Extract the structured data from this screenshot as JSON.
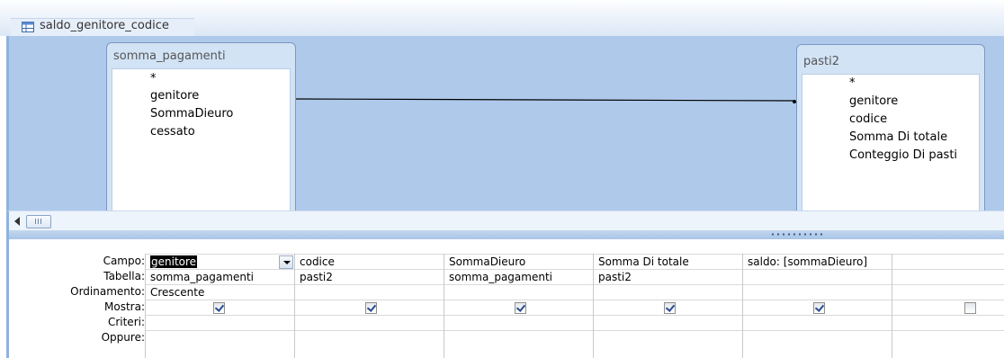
{
  "window": {
    "title": "saldo_genitore_codice"
  },
  "tables": [
    {
      "name": "somma_pagamenti",
      "fields": [
        "*",
        "genitore",
        "SommaDieuro",
        "cessato"
      ]
    },
    {
      "name": "pasti2",
      "fields": [
        "*",
        "genitore",
        "codice",
        "Somma Di totale",
        "Conteggio Di pasti"
      ]
    }
  ],
  "grid": {
    "row_labels": [
      "Campo:",
      "Tabella:",
      "Ordinamento:",
      "Mostra:",
      "Criteri:",
      "Oppure:"
    ],
    "columns": [
      {
        "campo": "genitore",
        "tabella": "somma_pagamenti",
        "ordinamento": "Crescente",
        "mostra": true,
        "criteri": "",
        "oppure": ""
      },
      {
        "campo": "codice",
        "tabella": "pasti2",
        "ordinamento": "",
        "mostra": true,
        "criteri": "",
        "oppure": ""
      },
      {
        "campo": "SommaDieuro",
        "tabella": "somma_pagamenti",
        "ordinamento": "",
        "mostra": true,
        "criteri": "",
        "oppure": ""
      },
      {
        "campo": "Somma Di totale",
        "tabella": "pasti2",
        "ordinamento": "",
        "mostra": true,
        "criteri": "",
        "oppure": ""
      },
      {
        "campo": "saldo: [sommaDieuro]",
        "tabella": "",
        "ordinamento": "",
        "mostra": true,
        "criteri": "",
        "oppure": ""
      },
      {
        "campo": "",
        "tabella": "",
        "ordinamento": "",
        "mostra": false,
        "criteri": "",
        "oppure": ""
      }
    ]
  },
  "colors": {
    "pane_bg": "#aec9ea",
    "table_header": "#d2e3f5",
    "selection": "#000000"
  }
}
